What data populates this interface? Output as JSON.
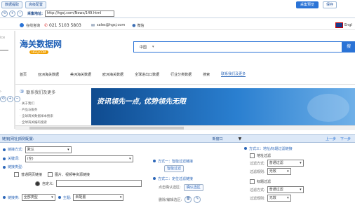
{
  "toolbar": {
    "btn_data_mining": "数据提取",
    "btn_advanced_config": "高级配置",
    "btn_collect_preview": "采集预览",
    "btn_save": "保存"
  },
  "address": {
    "label": "采集地址:",
    "url": "http://hgsj.com/News/149.html"
  },
  "site_top": {
    "online_label": "在线咨询",
    "phone": "021 5103 5803",
    "email": "sales@hgsj.com",
    "wechat": "微信",
    "lang": "Engl"
  },
  "site_header": {
    "logo_text": "海关数据网",
    "logo_sub": "HGSJ.COM",
    "search_select": "中国",
    "search_button": "搜"
  },
  "site_nav": [
    "首页",
    "亚洲海关数据",
    "美洲海关数据",
    "欧洲海关数据",
    "全球进出口数据",
    "行业分类数据",
    "搜索",
    "联系我们及更多"
  ],
  "sidebar": {
    "title": "联系我们及更多",
    "items": [
      "关于我们",
      "产品与服务",
      "全球海关数据样本搜索",
      "全球海关编码搜索"
    ]
  },
  "banner": {
    "text": "资讯领先一点, 优势领先无限"
  },
  "panel": {
    "title": "链接[网址]规则配置:",
    "open_mode": "新窗口",
    "prev": "上一步",
    "next": "下一步"
  },
  "form": {
    "link_mode_label": "链接方式:",
    "link_mode_value": "默认",
    "keyword_label": "关键词:",
    "keyword_value": "(空)",
    "link_type_label": "链接类型:",
    "opt_normal": "普通网页链接",
    "opt_image": "图片、视频等资源链接",
    "custom_label": "自定义:",
    "chain_label": "链接类:",
    "chain_value": "全部类型",
    "theme_label": "主题:",
    "theme_value": "未配置"
  },
  "middle": {
    "method1": "方式一：智能过滤链接",
    "smart_filter_btn": "智能过滤",
    "method2": "方式二：定位过滤链接",
    "click_select_label": "点击确认选区:",
    "confirm_btn": "确认选区",
    "delete_label": "删除/编辑选区:"
  },
  "right": {
    "method3": "方式三：地址/标题过滤链接",
    "addr_filter": "地址过滤",
    "filter_mode_label": "过滤方式:",
    "filter_mode_value": "普通过滤",
    "filter_rule_label": "过滤规则:",
    "filter_rule_value": "无效",
    "title_filter": "标题过滤",
    "filter_mode_value2": "普通过滤",
    "filter_rule_value2": "无效"
  },
  "colors": {
    "accent_blue": "#2a73d6",
    "brand_blue": "#1e5fb6",
    "banner_blue": "#1f6dbd",
    "panel_header": "#dce8f7"
  }
}
